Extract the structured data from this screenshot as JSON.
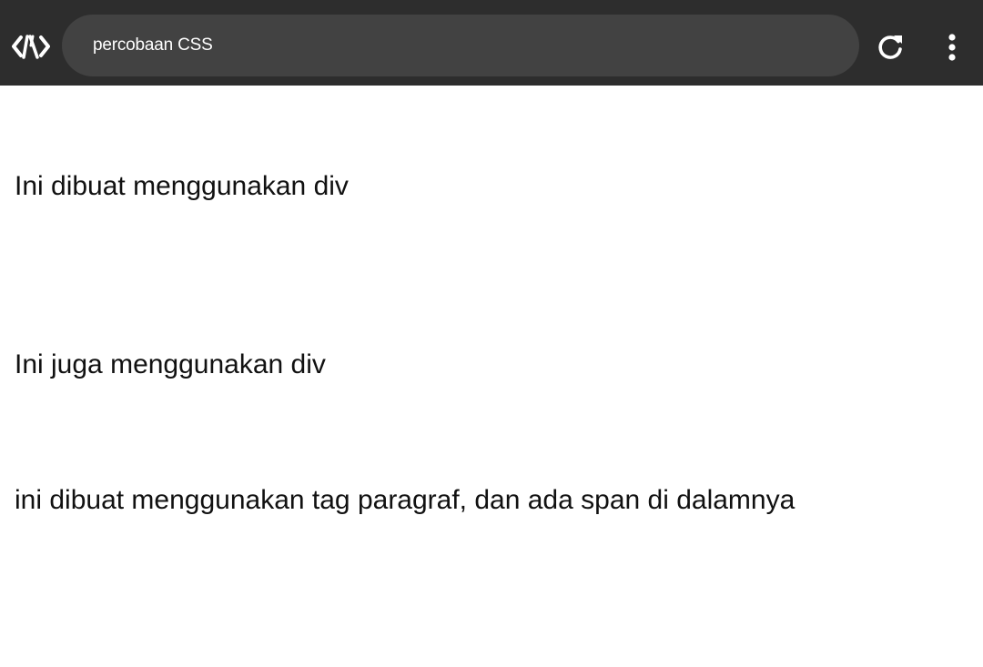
{
  "toolbar": {
    "logo_icon": "code-brackets-logo-icon",
    "address_text": "percobaan CSS",
    "reload_icon": "reload-icon",
    "menu_icon": "more-vertical-icon",
    "background": "#2d2d2d",
    "address_bar_background": "#424242"
  },
  "content": {
    "div_text_1": "Ini dibuat menggunakan div",
    "div_text_2": "Ini juga menggunakan div",
    "paragraph_text": "ini dibuat menggunakan tag paragraf, dan ada span di dalamnya"
  }
}
